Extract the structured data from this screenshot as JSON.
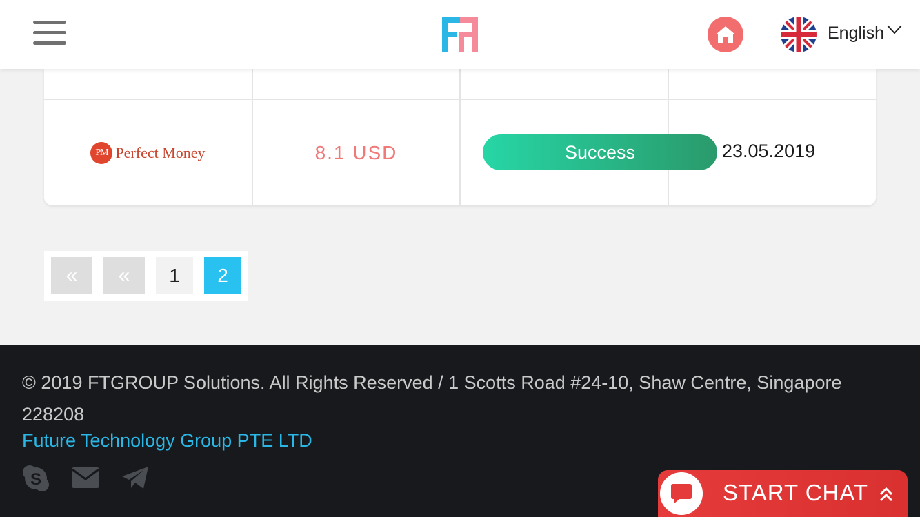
{
  "header": {
    "language": "English",
    "colors": {
      "home": "#f26d6d",
      "logo_blue": "#2ab7e6",
      "logo_pink": "#f48a9a"
    }
  },
  "table": {
    "rows": [
      {
        "method_logo_mark": "PM",
        "method_name": "Perfect Money",
        "amount": "8.1 USD",
        "status": "Success",
        "date": "23.05.2019"
      }
    ]
  },
  "pagination": {
    "first_label": "«",
    "prev_label": "«",
    "pages": [
      "1",
      "2"
    ],
    "active_page": "2"
  },
  "footer": {
    "copyright": "© 2019 FTGROUP Solutions. All Rights Reserved / 1 Scotts Road #24-10, Shaw Centre, Singapore 228208",
    "company": "Future Technology Group PTE LTD",
    "social_icons": [
      "skype-icon",
      "envelope-icon",
      "telegram-icon"
    ]
  },
  "chat": {
    "label": "START CHAT"
  }
}
